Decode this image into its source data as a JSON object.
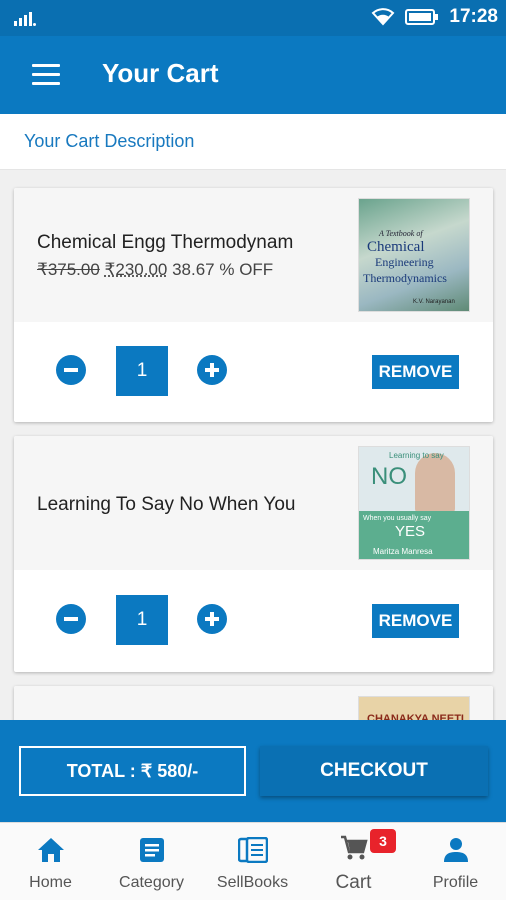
{
  "status_bar": {
    "time": "17:28"
  },
  "app_bar": {
    "title": "Your Cart"
  },
  "description": "Your Cart Description",
  "cart_items": [
    {
      "name": "Chemical Engg Thermodynam",
      "mrp": "₹375.00",
      "sale_price": "₹230.00",
      "discount": "38.67 % OFF",
      "quantity": "1",
      "remove_label": "REMOVE",
      "cover": {
        "line1": "A Textbook of",
        "line2": "Chemical",
        "line3": "Engineering",
        "line4": "Thermodynamics",
        "author": "K.V. Narayanan"
      }
    },
    {
      "name": "Learning To Say No When You",
      "quantity": "1",
      "remove_label": "REMOVE",
      "cover": {
        "top": "Learning to say",
        "no": "NO",
        "mid": "When you usually say",
        "yes": "YES",
        "author": "Maritza Manresa"
      }
    },
    {
      "cover": {
        "title": "CHANAKYA NEETI"
      }
    }
  ],
  "footer": {
    "total_label": "TOTAL : ₹ 580/-",
    "checkout_label": "CHECKOUT"
  },
  "bottom_nav": {
    "items": [
      {
        "label": "Home",
        "icon": "home-icon"
      },
      {
        "label": "Category",
        "icon": "category-icon"
      },
      {
        "label": "SellBooks",
        "icon": "sell-books-icon"
      },
      {
        "label": "Cart",
        "icon": "cart-icon"
      },
      {
        "label": "Profile",
        "icon": "profile-icon"
      }
    ],
    "cart_badge": "3"
  },
  "colors": {
    "primary": "#0b79c1",
    "status_bar": "#0a6fb1",
    "badge": "#e8232b",
    "link": "#1879bf"
  }
}
